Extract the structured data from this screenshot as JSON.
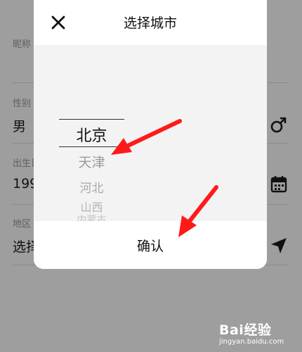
{
  "form": {
    "nickname_label": "昵称",
    "gender_label": "性别",
    "gender_value": "男",
    "birthday_label": "出生日",
    "birthday_value": "199",
    "region_label": "地区",
    "region_value": "选择"
  },
  "dialog": {
    "title": "选择城市",
    "confirm_label": "确认",
    "picker_items": [
      "北京",
      "天津",
      "河北",
      "山西",
      "内蒙古"
    ],
    "selected_index": 0
  },
  "watermark": {
    "brand": "Bai经验",
    "url": "jingyan.baidu.com"
  },
  "colors": {
    "backdrop": "#9e9e9e",
    "dialog": "#ffffff",
    "picker": "#f3f3f3",
    "arrow": "#ff1a1a"
  },
  "icons": {
    "close": "close-icon",
    "gender": "male-icon",
    "birthday": "calendar-icon",
    "region": "location-arrow-icon"
  }
}
